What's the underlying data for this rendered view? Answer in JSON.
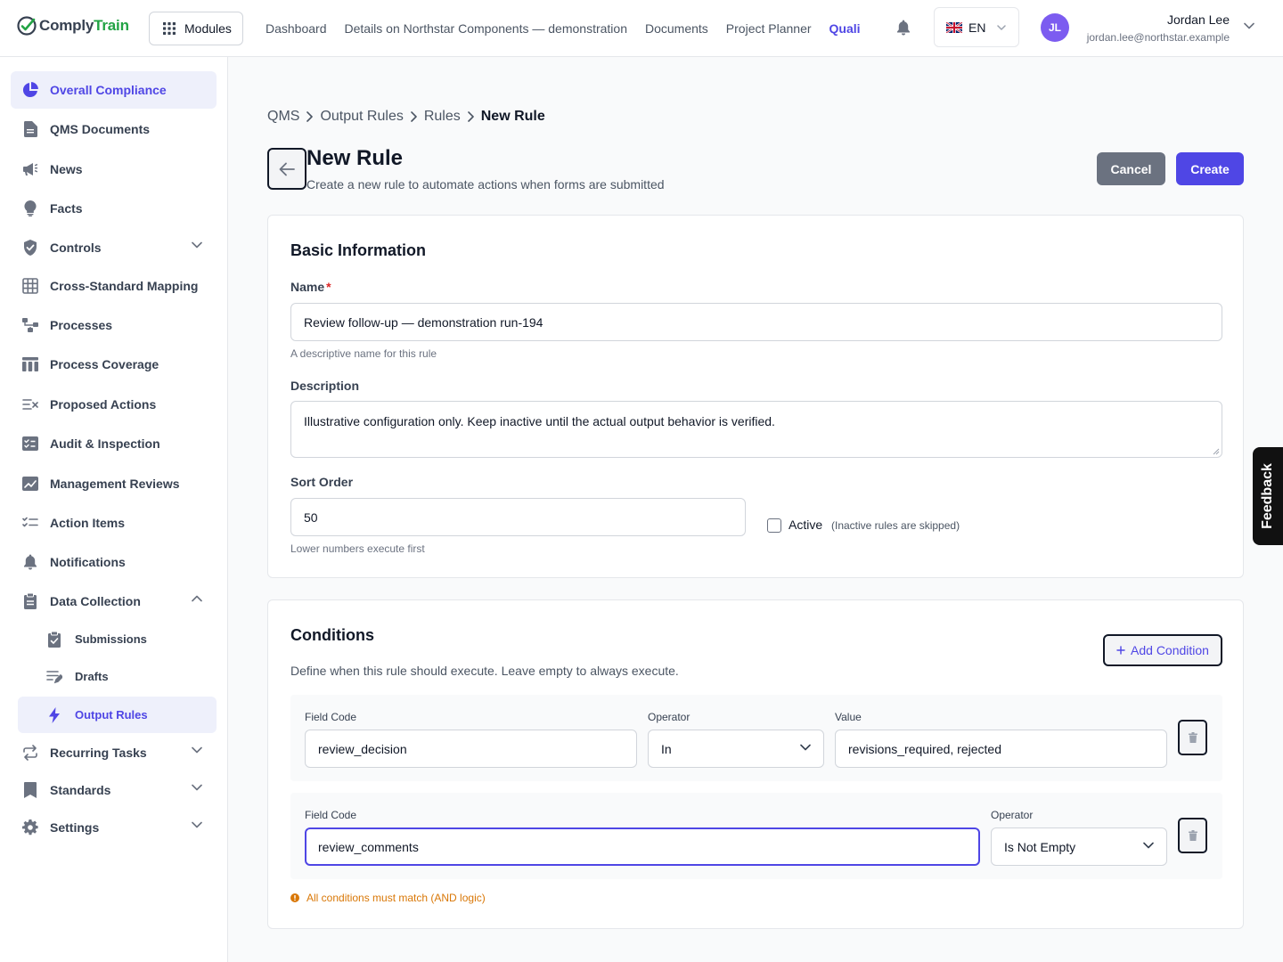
{
  "header": {
    "logo_text_a": "Comply",
    "logo_text_b": "Train",
    "modules_label": "Modules",
    "nav": [
      "Dashboard",
      "Details on Northstar Components — demonstration",
      "Documents",
      "Project Planner",
      "Quali"
    ],
    "language": "EN",
    "user_initials": "JL",
    "user_name": "Jordan Lee",
    "user_email": "jordan.lee@northstar.example"
  },
  "sidebar": {
    "items": [
      "Overall Compliance",
      "QMS Documents",
      "News",
      "Facts",
      "Controls",
      "Cross-Standard Mapping",
      "Processes",
      "Process Coverage",
      "Proposed Actions",
      "Audit & Inspection",
      "Management Reviews",
      "Action Items",
      "Notifications",
      "Data Collection",
      "Recurring Tasks",
      "Standards",
      "Settings"
    ],
    "sub_items": [
      "Submissions",
      "Drafts",
      "Output Rules"
    ]
  },
  "breadcrumb": [
    "QMS",
    "Output Rules",
    "Rules",
    "New Rule"
  ],
  "page": {
    "title": "New Rule",
    "subtitle": "Create a new rule to automate actions when forms are submitted",
    "cancel_label": "Cancel",
    "create_label": "Create"
  },
  "basic": {
    "title": "Basic Information",
    "name_label": "Name",
    "name_required": "*",
    "name_value": "Review follow-up — demonstration run-194",
    "name_help": "A descriptive name for this rule",
    "desc_label": "Description",
    "desc_value": "Illustrative configuration only. Keep inactive until the actual output behavior is verified.",
    "sort_label": "Sort Order",
    "sort_value": "50",
    "sort_help": "Lower numbers execute first",
    "active_label": "Active",
    "active_hint": "(Inactive rules are skipped)",
    "active_checked": false
  },
  "conditions": {
    "title": "Conditions",
    "add_label": "Add Condition",
    "description": "Define when this rule should execute. Leave empty to always execute.",
    "field_code_label": "Field Code",
    "operator_label": "Operator",
    "value_label": "Value",
    "rows": [
      {
        "field_code": "review_decision",
        "operator": "In",
        "value": "revisions_required, rejected"
      },
      {
        "field_code": "review_comments",
        "operator": "Is Not Empty"
      }
    ],
    "note": "All conditions must match (AND logic)"
  },
  "feedback_label": "Feedback",
  "colors": {
    "accent": "#4f46e5",
    "brand_green": "#22a344",
    "warning": "#d97706",
    "avatar": "#7c5cf0"
  }
}
